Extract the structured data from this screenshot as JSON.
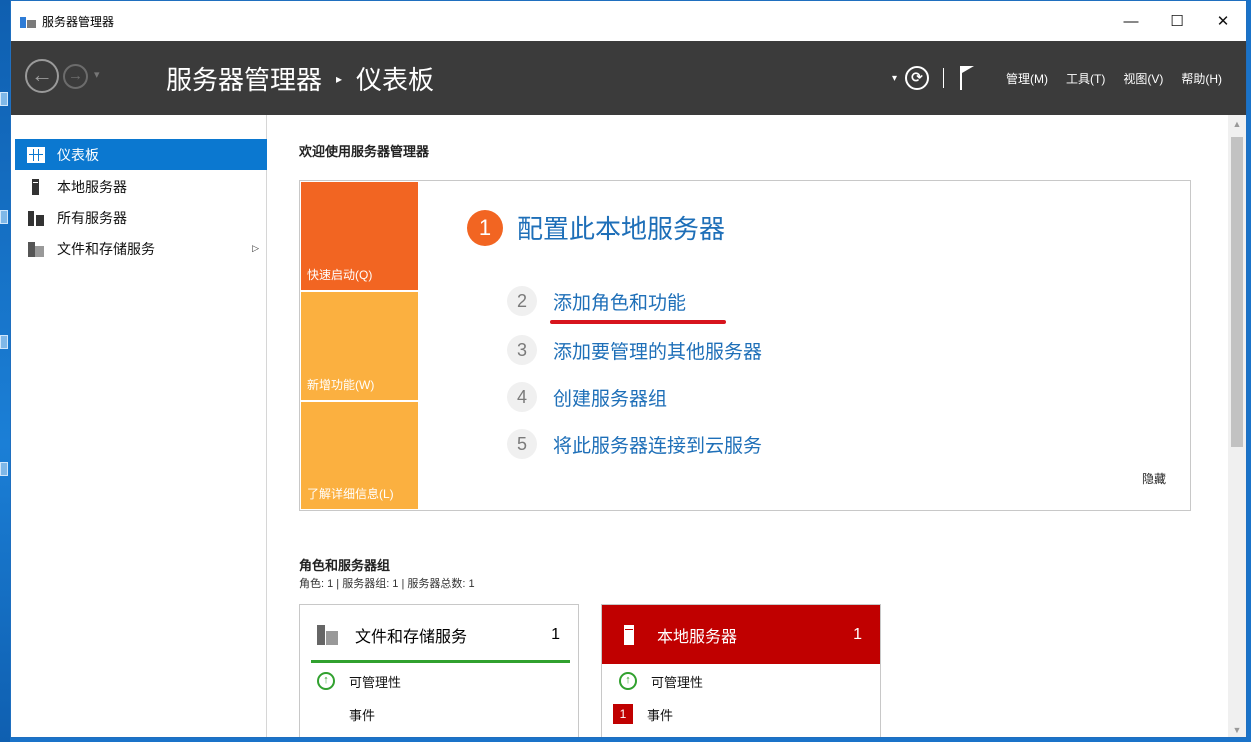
{
  "window": {
    "title": "服务器管理器",
    "controls": {
      "minimize": "—",
      "maximize": "☐",
      "close": "✕"
    }
  },
  "header": {
    "breadcrumb_root": "服务器管理器",
    "breadcrumb_separator": "▸",
    "breadcrumb_current": "仪表板",
    "nav_back": "←",
    "nav_forward": "→",
    "nav_dropdown": "▾",
    "header_dropdown": "▾",
    "refresh_glyph": "⟳",
    "menu": [
      "管理(M)",
      "工具(T)",
      "视图(V)",
      "帮助(H)"
    ]
  },
  "sidebar": {
    "items": [
      {
        "label": "仪表板",
        "icon": "dashboard-icon",
        "active": true
      },
      {
        "label": "本地服务器",
        "icon": "server-icon"
      },
      {
        "label": "所有服务器",
        "icon": "servers-icon"
      },
      {
        "label": "文件和存储服务",
        "icon": "files-icon",
        "arrow": "▷"
      }
    ]
  },
  "main": {
    "welcome_title": "欢迎使用服务器管理器",
    "tiles": [
      "快速启动(Q)",
      "新增功能(W)",
      "了解详细信息(L)"
    ],
    "steps": [
      {
        "num": "1",
        "label": "配置此本地服务器"
      },
      {
        "num": "2",
        "label": "添加角色和功能"
      },
      {
        "num": "3",
        "label": "添加要管理的其他服务器"
      },
      {
        "num": "4",
        "label": "创建服务器组"
      },
      {
        "num": "5",
        "label": "将此服务器连接到云服务"
      }
    ],
    "hide_label": "隐藏",
    "roles_title": "角色和服务器组",
    "roles_summary": "角色: 1 | 服务器组: 1 | 服务器总数: 1",
    "cards": [
      {
        "title": "文件和存储服务",
        "count": "1",
        "rows": [
          {
            "label": "可管理性",
            "status": "ok"
          },
          {
            "label": "事件"
          }
        ]
      },
      {
        "title": "本地服务器",
        "count": "1",
        "color": "#c00000",
        "rows": [
          {
            "label": "可管理性",
            "status": "ok"
          },
          {
            "label": "事件",
            "badge": "1"
          }
        ]
      }
    ]
  },
  "colors": {
    "accent": "#0b78d0",
    "quickstart_tile": "#f26522",
    "secondary_tile": "#fbb040",
    "link": "#1e6fb8",
    "alert": "#c00000",
    "ok": "#31a12f",
    "header_bg": "#3b3b3b"
  }
}
